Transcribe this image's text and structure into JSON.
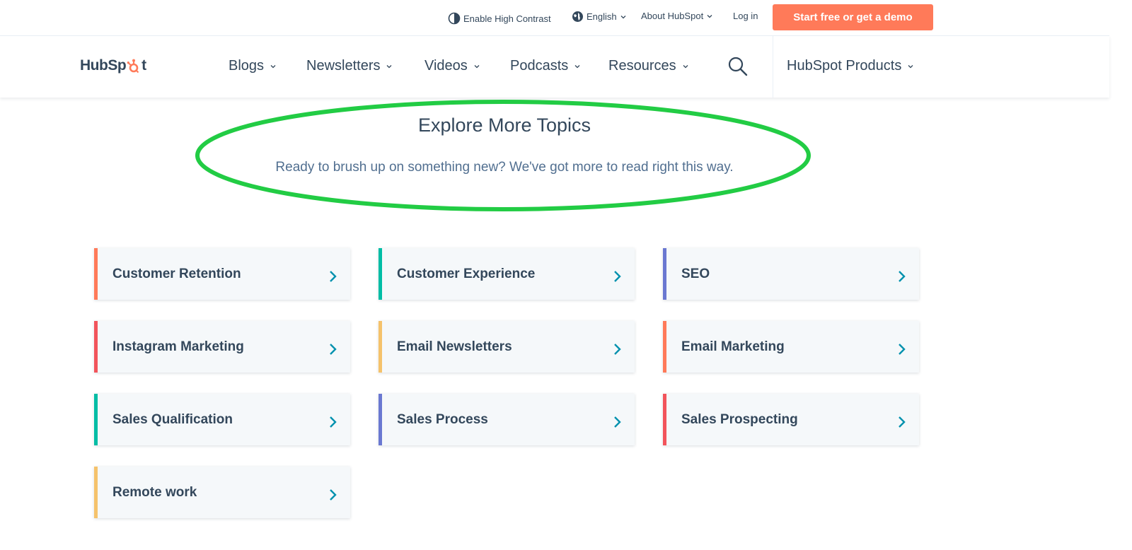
{
  "utility": {
    "contrast_label": "Enable High Contrast",
    "language_label": "English",
    "about_label": "About HubSpot",
    "login_label": "Log in",
    "cta_label": "Start free or get a demo"
  },
  "nav": {
    "logo_text_left": "HubSp",
    "logo_text_right": "t",
    "links": [
      "Blogs",
      "Newsletters",
      "Videos",
      "Podcasts",
      "Resources"
    ],
    "products_label": "HubSpot Products"
  },
  "intro": {
    "title": "Explore More Topics",
    "text": "Ready to brush up on something new? We've got more to read right this way."
  },
  "topics": [
    {
      "label": "Customer Retention",
      "color": "#ff7a59"
    },
    {
      "label": "Customer Experience",
      "color": "#00bda5"
    },
    {
      "label": "SEO",
      "color": "#6a78d1"
    },
    {
      "label": "Instagram Marketing",
      "color": "#f2545b"
    },
    {
      "label": "Email Newsletters",
      "color": "#f5c26b"
    },
    {
      "label": "Email Marketing",
      "color": "#ff7a59"
    },
    {
      "label": "Sales Qualification",
      "color": "#00bda5"
    },
    {
      "label": "Sales Process",
      "color": "#6a78d1"
    },
    {
      "label": "Sales Prospecting",
      "color": "#f2545b"
    },
    {
      "label": "Remote work",
      "color": "#f5c26b"
    }
  ],
  "colors": {
    "accent": "#ff7a59",
    "chevron": "#0091ae",
    "highlight_ellipse": "#22cc44",
    "text": "#33475b"
  },
  "icons": {
    "contrast": "contrast-icon",
    "language": "globe-icon",
    "dropdown": "chevron-down-icon",
    "search": "search-icon",
    "topic_arrow": "chevron-right-icon"
  }
}
